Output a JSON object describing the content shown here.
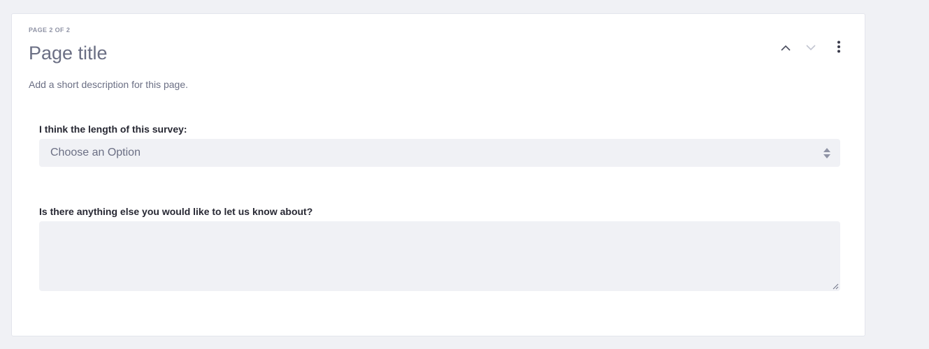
{
  "page": {
    "indicator": "PAGE 2 OF 2",
    "title": "Page title",
    "description": "Add a short description for this page."
  },
  "toolbar": {
    "icons": [
      "chevron-up-icon",
      "chevron-down-icon",
      "vertical-ellipsis-icon"
    ]
  },
  "fields": {
    "survey_length": {
      "label": "I think the length of this survey:",
      "placeholder": "Choose an Option"
    },
    "comments": {
      "label": "Is there anything else you would like to let us know about?",
      "value": ""
    }
  },
  "colors": {
    "background": "#f0f1f5",
    "card": "#ffffff",
    "input_background": "#f0f1f5",
    "title_text": "#6b6f84",
    "label_text": "#272833",
    "muted_text": "#8f93a5"
  }
}
